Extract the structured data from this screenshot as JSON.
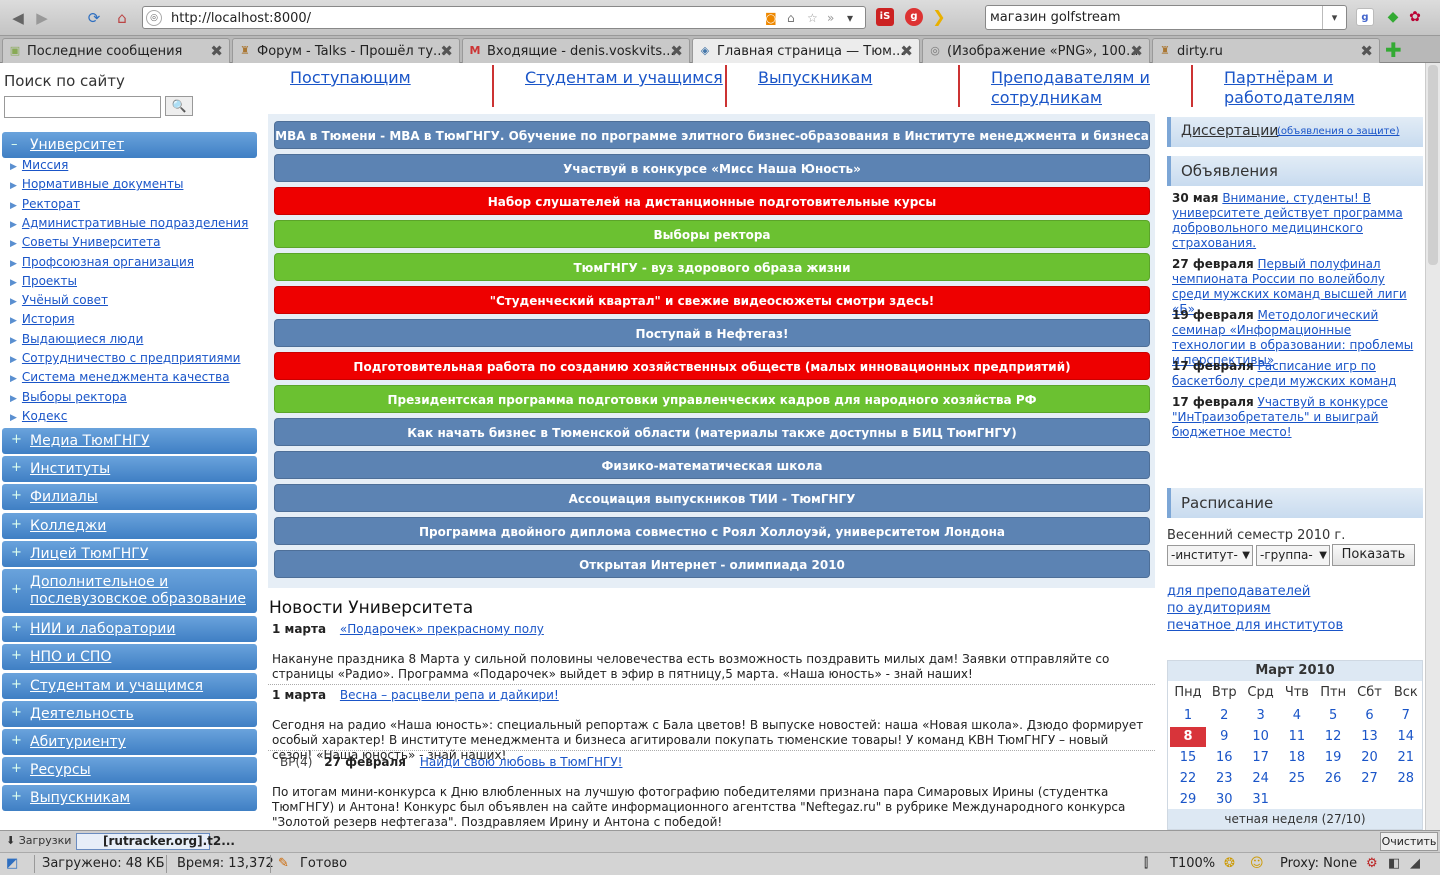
{
  "browser": {
    "url": "http://localhost:8000/",
    "search_query": "магазин golfstream",
    "tabs": [
      {
        "title": "Последние сообщения"
      },
      {
        "title": "Форум - Talks - Прошёл ту..."
      },
      {
        "title": "Входящие - denis.voskvits..."
      },
      {
        "title": "Главная страница — Тюм..."
      },
      {
        "title": "(Изображение «PNG», 100..."
      },
      {
        "title": "dirty.ru"
      }
    ],
    "addon_labels": {
      "is": "iS"
    },
    "downloads": {
      "label": "Загрузки",
      "item": "[rutracker.org].t2...",
      "clear": "Очистить"
    },
    "status": {
      "loaded": "Загружено: 48 КБ",
      "time": "Время: 13,372",
      "state": "Готово",
      "zoom": "T100%",
      "proxy": "Proxy: None"
    }
  },
  "sidebar": {
    "search_title": "Поиск по сайту",
    "search_button": "🔍",
    "university": {
      "label": "Университет",
      "items": [
        "Миссия",
        "Нормативные документы",
        "Ректорат",
        "Административные подразделения",
        "Советы Университета",
        "Профсоюзная организация",
        "Проекты",
        "Учёный совет",
        "История",
        "Выдающиеся люди",
        "Сотрудничество с предприятиями",
        "Система менеджмента качества",
        "Выборы ректора",
        "Кодекс"
      ]
    },
    "menu": [
      "Медиа ТюмГНГУ",
      "Институты",
      "Филиалы",
      "Колледжи",
      "Лицей ТюмГНГУ",
      "Дополнительное и послевузовское образование",
      "НИИ и лаборатории",
      "НПО и СПО",
      "Студентам и учащимся",
      "Деятельность",
      "Абитуриенту",
      "Ресурсы",
      "Выпускникам"
    ]
  },
  "topnav": [
    "Поступающим",
    "Студентам и учащимся",
    "Выпускникам",
    "Преподавателям и сотрудникам",
    "Партнёрам и работодателям"
  ],
  "banners": [
    {
      "text": "MBA в Тюмени - MBA в ТюмГНГУ. Обучение по программе элитного бизнес-образования в Институте менеджмента и бизнеса",
      "color": "#5c83b3"
    },
    {
      "text": "Участвуй в конкурсе «Мисс Наша Юность»",
      "color": "#5c83b3"
    },
    {
      "text": "Набор слушателей на дистанционные подготовительные курсы",
      "color": "#ee0000"
    },
    {
      "text": "Выборы ректора",
      "color": "#6bc131"
    },
    {
      "text": "ТюмГНГУ - вуз здорового образа жизни",
      "color": "#6bc131"
    },
    {
      "text": "\"Студенческий квартал\" и свежие видеосюжеты смотри здесь!",
      "color": "#ee0000"
    },
    {
      "text": "Поступай в Нефтегаз!",
      "color": "#5c83b3"
    },
    {
      "text": "Подготовительная работа по созданию хозяйственных обществ (малых инновационных предприятий)",
      "color": "#ee0000"
    },
    {
      "text": "Президентская программа подготовки управленческих кадров для народного хозяйства РФ",
      "color": "#6bc131"
    },
    {
      "text": "Как начать бизнес в Тюменской области (материалы также доступны в БИЦ ТюмГНГУ)",
      "color": "#5c83b3"
    },
    {
      "text": "Физико-математическая школа",
      "color": "#5c83b3"
    },
    {
      "text": "Ассоциация выпускников ТИИ - ТюмГНГУ",
      "color": "#5c83b3"
    },
    {
      "text": "Программа двойного диплома совместно с Роял Холлоуэй, университетом Лондона",
      "color": "#5c83b3"
    },
    {
      "text": "Открытая Интернет - олимпиада 2010",
      "color": "#5c83b3"
    }
  ],
  "news": {
    "title": "Новости Университета",
    "items": [
      {
        "date": "1 марта",
        "link": "«Подарочек» прекрасному полу",
        "text": "Накануне праздника 8 Марта у сильной половины человечества есть возможность поздравить милых дам! Заявки отправляйте со страницы «Радио». Программа «Подарочек» выйдет в эфир в пятницу,5 марта. «Наша юность» - знай наших!"
      },
      {
        "date": "1 марта",
        "link": "Весна – расцвели репа и дайкири!",
        "text": "Сегодня на радио «Наша юность»: специальный репортаж с Бала цветов! В выпуске новостей: наша «Новая школа». Дзюдо формирует особый характер! В институте менеджмента и бизнеса агитировали покупать тюменские товары! У команд КВН ТюмГНГУ – новый сезон! «Наша юность» - знай наших!"
      },
      {
        "prefix": "ВР(4)",
        "date": "27 февраля",
        "link": "Найди свою любовь в ТюмГНГУ!",
        "text": "По итогам мини-конкурса к Дню влюбленных на лучшую фотографию победителями признана пара Симаровых Ирины (студентка ТюмГНГУ) и Антона! Конкурс был объявлен на сайте информационного агентства \"Neftegaz.ru\" в рубрике Международного конкурса \"Золотой резерв нефтегаза\". Поздравляем Ирину и Антона с победой!"
      }
    ]
  },
  "right": {
    "dissertations": {
      "label": "Диссертации",
      "note": "(объявления о защите)"
    },
    "announcements": {
      "title": "Объявления",
      "items": [
        {
          "date": "30 мая",
          "text": "Внимание, студенты! В университете действует программа добровольного медицинского страхования."
        },
        {
          "date": "27 февраля",
          "text": "Первый полуфинал чемпионата России по волейболу среди мужских команд высшей лиги «Б»"
        },
        {
          "date": "19 февраля",
          "text": "Методологический семинар «Информационные технологии в образовании: проблемы и перспективы»"
        },
        {
          "date": "17 февраля",
          "text": "Расписание игр по баскетболу среди мужских команд"
        },
        {
          "date": "17 февраля",
          "text": "Участвуй в конкурсе \"ИнТраизобретатель\" и выиграй бюджетное место!"
        }
      ]
    },
    "schedule": {
      "title": "Расписание",
      "semester": "Весенний семестр 2010 г.",
      "institute_select": "-институт-",
      "group_select": "-группа-",
      "show_button": "Показать",
      "links": [
        "для преподавателей",
        "по аудиториям",
        "печатное для институтов"
      ]
    },
    "calendar": {
      "title": "Март 2010",
      "weekdays": [
        "Пнд",
        "Втр",
        "Срд",
        "Чтв",
        "Птн",
        "Сбт",
        "Вск"
      ],
      "weeks": [
        [
          "1",
          "2",
          "3",
          "4",
          "5",
          "6",
          "7"
        ],
        [
          "8",
          "9",
          "10",
          "11",
          "12",
          "13",
          "14"
        ],
        [
          "15",
          "16",
          "17",
          "18",
          "19",
          "20",
          "21"
        ],
        [
          "22",
          "23",
          "24",
          "25",
          "26",
          "27",
          "28"
        ],
        [
          "29",
          "30",
          "31",
          "",
          "",
          "",
          ""
        ]
      ],
      "today": "8",
      "footer": "четная неделя (27/10)"
    }
  }
}
